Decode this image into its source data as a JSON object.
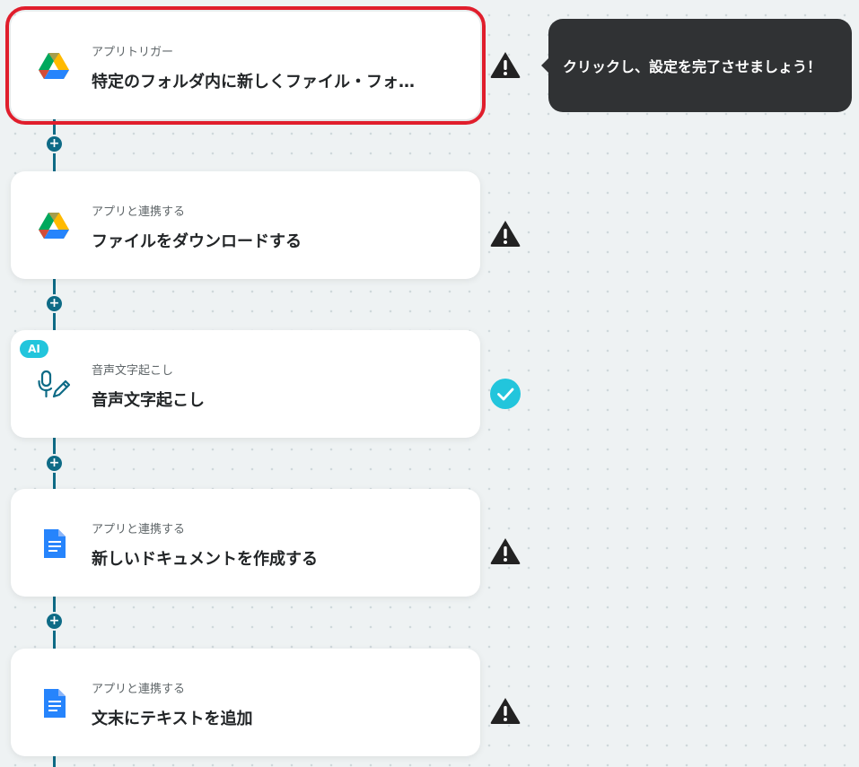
{
  "steps": [
    {
      "kind": "アプリトリガー",
      "title": "特定のフォルダ内に新しくファイル・フォ…",
      "app_icon": "google-drive-icon",
      "status": "warning",
      "selected": true
    },
    {
      "kind": "アプリと連携する",
      "title": "ファイルをダウンロードする",
      "app_icon": "google-drive-icon",
      "status": "warning"
    },
    {
      "kind": "音声文字起こし",
      "title": "音声文字起こし",
      "app_icon": "microphone-pen-icon",
      "badge": "AI",
      "status": "complete"
    },
    {
      "kind": "アプリと連携する",
      "title": "新しいドキュメントを作成する",
      "app_icon": "google-docs-icon",
      "status": "warning"
    },
    {
      "kind": "アプリと連携する",
      "title": "文末にテキストを追加",
      "app_icon": "google-docs-icon",
      "status": "warning"
    }
  ],
  "tooltip": {
    "text": "クリックし、設定を完了させましょう！"
  },
  "add_button_symbol": "+",
  "colors": {
    "background": "#eef2f3",
    "connector": "#0e6b86",
    "selected_outline": "#e01e2c",
    "complete": "#22c5dc",
    "warning": "#222222",
    "tooltip_bg": "#303234"
  }
}
